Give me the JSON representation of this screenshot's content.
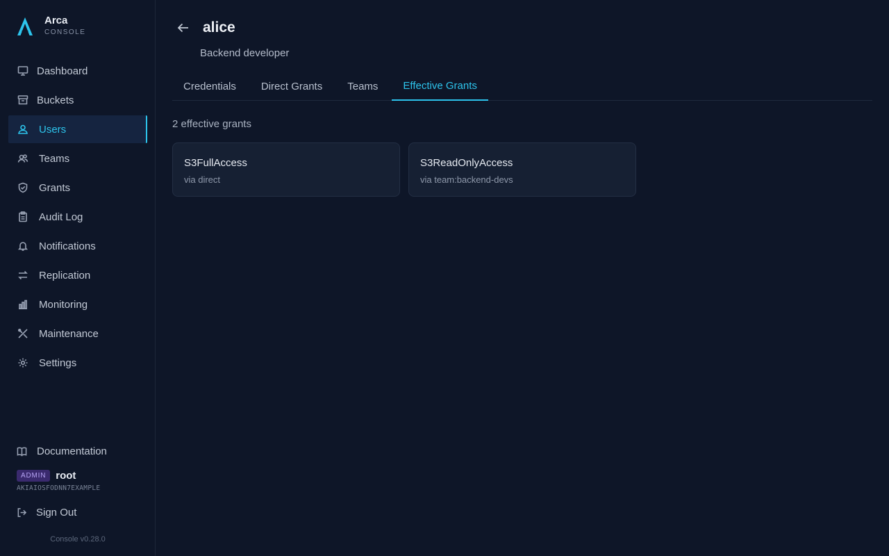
{
  "brand": {
    "name": "Arca",
    "subtitle": "CONSOLE",
    "logo_icon": "arca-logo-icon",
    "accent": "#2dc4ec"
  },
  "sidebar": {
    "items": [
      {
        "label": "Dashboard",
        "icon": "monitor-icon",
        "active": false
      },
      {
        "label": "Buckets",
        "icon": "archive-icon",
        "active": false
      },
      {
        "label": "Users",
        "icon": "user-icon",
        "active": true
      },
      {
        "label": "Teams",
        "icon": "users-icon",
        "active": false
      },
      {
        "label": "Grants",
        "icon": "shield-icon",
        "active": false
      },
      {
        "label": "Audit Log",
        "icon": "clipboard-icon",
        "active": false
      },
      {
        "label": "Notifications",
        "icon": "bell-icon",
        "active": false
      },
      {
        "label": "Replication",
        "icon": "arrows-icon",
        "active": false
      },
      {
        "label": "Monitoring",
        "icon": "bar-chart-icon",
        "active": false
      },
      {
        "label": "Maintenance",
        "icon": "tools-icon",
        "active": false
      },
      {
        "label": "Settings",
        "icon": "gear-icon",
        "active": false
      }
    ],
    "documentation": "Documentation",
    "user": {
      "badge": "ADMIN",
      "name": "root",
      "access_key": "AKIAIOSFODNN7EXAMPLE"
    },
    "sign_out": "Sign Out",
    "version": "Console v0.28.0"
  },
  "header": {
    "title": "alice",
    "description": "Backend developer"
  },
  "tabs": [
    {
      "label": "Credentials",
      "active": false
    },
    {
      "label": "Direct Grants",
      "active": false
    },
    {
      "label": "Teams",
      "active": false
    },
    {
      "label": "Effective Grants",
      "active": true
    }
  ],
  "content": {
    "count_text": "2 effective grants",
    "grants": [
      {
        "name": "S3FullAccess",
        "source": "via direct"
      },
      {
        "name": "S3ReadOnlyAccess",
        "source": "via team:backend-devs"
      }
    ]
  }
}
